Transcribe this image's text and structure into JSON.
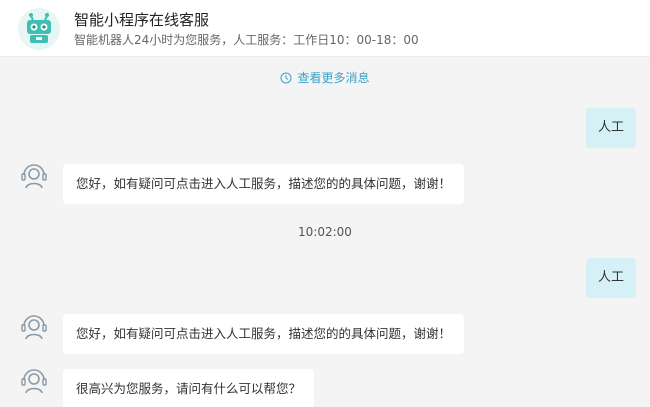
{
  "header": {
    "title": "智能小程序在线客服",
    "subtitle": "智能机器人24小时为您服务，人工服务：工作日10：00-18：00"
  },
  "history_link": "查看更多消息",
  "chat": {
    "user_msg_1": "人工",
    "bot_msg_1": "您好，如有疑问可点击进入人工服务，描述您的的具体问题，谢谢！",
    "timestamp": "10:02:00",
    "user_msg_2": "人工",
    "bot_msg_2": "您好，如有疑问可点击进入人工服务，描述您的的具体问题，谢谢！",
    "bot_msg_3": "很高兴为您服务，请问有什么可以帮您？"
  },
  "icons": {
    "logo": "robot-logo-icon",
    "history": "clock-icon",
    "bot_avatar": "agent-headset-icon"
  },
  "colors": {
    "accent": "#3aa3c8",
    "user_bubble": "#d6f0f8",
    "logo_teal": "#3dbfb3",
    "background": "#f4f4f5"
  }
}
